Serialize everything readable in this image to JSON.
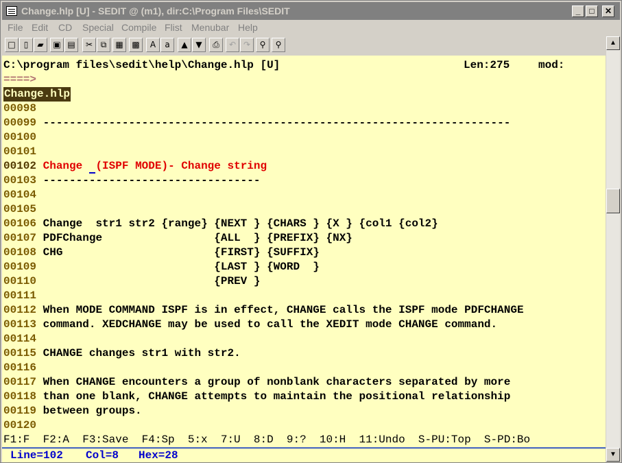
{
  "window": {
    "title": "Change.hlp [U] - SEDIT @ (m1), dir:C:\\Program Files\\SEDIT",
    "minimize": "_",
    "maximize": "□",
    "close": "✕"
  },
  "menubar": [
    "File",
    "Edit",
    "CD",
    "Special",
    "Compile",
    "Flist",
    "Menubar",
    "Help"
  ],
  "toolbar": {
    "tools": [
      {
        "name": "new-file-icon",
        "glyph": "□"
      },
      {
        "name": "new-doc-icon",
        "glyph": "▯"
      },
      {
        "name": "open-folder-icon",
        "glyph": "▰"
      },
      {
        "name": "save-icon",
        "glyph": "▣"
      },
      {
        "name": "save-all-icon",
        "glyph": "▤"
      },
      {
        "name": "cut-icon",
        "glyph": "✂"
      },
      {
        "name": "copy-icon",
        "glyph": "⧉"
      },
      {
        "name": "paste-icon",
        "glyph": "▦"
      },
      {
        "name": "clipboard-icon",
        "glyph": "▩"
      },
      {
        "name": "uppercase-icon",
        "glyph": "A"
      },
      {
        "name": "lowercase-icon",
        "glyph": "a"
      },
      {
        "name": "bookmark-up-icon",
        "glyph": "▲"
      },
      {
        "name": "bookmark-down-icon",
        "glyph": "▼"
      },
      {
        "name": "print-icon",
        "glyph": "⎙"
      },
      {
        "name": "undo-icon",
        "glyph": "↶"
      },
      {
        "name": "redo-icon",
        "glyph": "↷"
      },
      {
        "name": "find-icon",
        "glyph": "⚲"
      },
      {
        "name": "find-next-icon",
        "glyph": "⚲"
      }
    ]
  },
  "editor": {
    "header_path": "C:\\program files\\sedit\\help\\Change.hlp [U]",
    "header_len": "Len:275",
    "header_mod": "mod:",
    "prompt": "====>",
    "file_label": "Change.hlp",
    "lines": [
      {
        "num": "00098",
        "text": ""
      },
      {
        "num": "00099",
        "text": "-----------------------------------------------------------------------"
      },
      {
        "num": "00100",
        "text": ""
      },
      {
        "num": "00101",
        "text": ""
      },
      {
        "num": "00102",
        "text_a": "Change ",
        "cursor_char": " ",
        "text_b": "(ISPF MODE)- Change string",
        "current": true
      },
      {
        "num": "00103",
        "text": "---------------------------------"
      },
      {
        "num": "00104",
        "text": ""
      },
      {
        "num": "00105",
        "text": ""
      },
      {
        "num": "00106",
        "text": "Change  str1 str2 {range} {NEXT } {CHARS } {X } {col1 {col2}"
      },
      {
        "num": "00107",
        "text": "PDFChange                 {ALL  } {PREFIX} {NX}"
      },
      {
        "num": "00108",
        "text": "CHG                       {FIRST} {SUFFIX}"
      },
      {
        "num": "00109",
        "text": "                          {LAST } {WORD  }"
      },
      {
        "num": "00110",
        "text": "                          {PREV }"
      },
      {
        "num": "00111",
        "text": ""
      },
      {
        "num": "00112",
        "text": "When MODE COMMAND ISPF is in effect, CHANGE calls the ISPF mode PDFCHANGE"
      },
      {
        "num": "00113",
        "text": "command. XEDCHANGE may be used to call the XEDIT mode CHANGE command."
      },
      {
        "num": "00114",
        "text": ""
      },
      {
        "num": "00115",
        "text": "CHANGE changes str1 with str2."
      },
      {
        "num": "00116",
        "text": ""
      },
      {
        "num": "00117",
        "text": "When CHANGE encounters a group of nonblank characters separated by more"
      },
      {
        "num": "00118",
        "text": "than one blank, CHANGE attempts to maintain the positional relationship"
      },
      {
        "num": "00119",
        "text": "between groups."
      },
      {
        "num": "00120",
        "text": ""
      }
    ],
    "fkeys": "F1:F  F2:A  F3:Save  F4:Sp  5:x  7:U  8:D  9:?  10:H  11:Undo  S-PU:Top  S-PD:Bo"
  },
  "status": {
    "line": "Line=102",
    "col": "Col=8",
    "hex": "Hex=28"
  },
  "colors": {
    "editor_bg": "#ffffc0",
    "red_text": "#e00000",
    "status_blue": "#0000cc"
  }
}
